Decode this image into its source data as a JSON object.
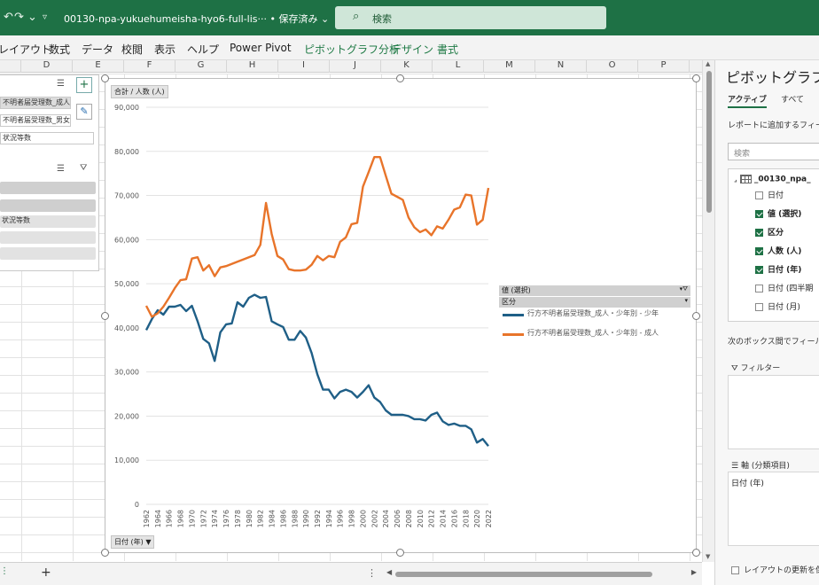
{
  "titlebar": {
    "undo_icon": "↶",
    "redo_icon": "↷ ⌄",
    "qa_more": "▿",
    "filename": "00130-npa-yukuehumeisha-hyo6-full-lis··· • 保存済み ⌄",
    "search_placeholder": "検索",
    "search_icon": "search-icon",
    "color": "#1e7145"
  },
  "menu": {
    "items": [
      "レイアウト",
      "数式",
      "データ",
      "校閲",
      "表示",
      "ヘルプ",
      "Power Pivot"
    ],
    "context_items": [
      "ピボットグラフ分析",
      "デザイン",
      "書式"
    ]
  },
  "columns": [
    "D",
    "E",
    "F",
    "G",
    "H",
    "I",
    "J",
    "K",
    "L",
    "M",
    "N",
    "O",
    "P"
  ],
  "field_panel": {
    "rows": [
      "不明者届受理数_成人・少",
      "不明者届受理数_男女別",
      "状況等数"
    ],
    "mid_row": "状況等数",
    "add_icon": "+",
    "brush_icon": "brush-icon",
    "list_icon": "list-icon",
    "filter_icon": "filter-clear-icon"
  },
  "chart": {
    "value_button": "合計 / 人数 (人)",
    "axis_button": "日付 (年) ▼",
    "legend_header_1": "値 (選択)",
    "legend_header_2": "区分"
  },
  "chart_data": {
    "type": "line",
    "x": [
      1962,
      1963,
      1964,
      1965,
      1966,
      1967,
      1968,
      1969,
      1970,
      1971,
      1972,
      1973,
      1974,
      1975,
      1976,
      1977,
      1978,
      1979,
      1980,
      1981,
      1982,
      1983,
      1984,
      1985,
      1986,
      1987,
      1988,
      1989,
      1990,
      1991,
      1992,
      1993,
      1994,
      1995,
      1996,
      1997,
      1998,
      1999,
      2000,
      2001,
      2002,
      2003,
      2004,
      2005,
      2006,
      2007,
      2008,
      2009,
      2010,
      2011,
      2012,
      2013,
      2014,
      2015,
      2016,
      2017,
      2018,
      2019,
      2020,
      2021,
      2022
    ],
    "xticks": [
      1962,
      1964,
      1966,
      1968,
      1970,
      1972,
      1974,
      1976,
      1978,
      1980,
      1982,
      1984,
      1986,
      1988,
      1990,
      1992,
      1994,
      1996,
      1998,
      2000,
      2002,
      2004,
      2006,
      2008,
      2010,
      2012,
      2014,
      2016,
      2018,
      2020,
      2022
    ],
    "yticks": [
      0,
      10000,
      20000,
      30000,
      40000,
      50000,
      60000,
      70000,
      80000,
      90000
    ],
    "ytick_labels": [
      "0",
      "10,000",
      "20,000",
      "30,000",
      "40,000",
      "50,000",
      "60,000",
      "70,000",
      "80,000",
      "90,000"
    ],
    "ylim": [
      0,
      90000
    ],
    "series": [
      {
        "name": "行方不明者届受理数_成人・少年別 - 少年",
        "color": "#1f5f87",
        "values": [
          39500,
          42000,
          44000,
          43000,
          44800,
          44800,
          45200,
          43800,
          45000,
          41500,
          37500,
          36500,
          32500,
          39000,
          40800,
          41000,
          45800,
          44800,
          46800,
          47500,
          46800,
          47000,
          41500,
          40800,
          40200,
          37300,
          37300,
          39300,
          37800,
          34300,
          29500,
          26000,
          26000,
          24000,
          25500,
          26000,
          25500,
          24200,
          25500,
          27000,
          24200,
          23200,
          21300,
          20300,
          20300,
          20300,
          20000,
          19300,
          19300,
          19000,
          20300,
          20800,
          18800,
          18000,
          18300,
          17800,
          17800,
          17000,
          14000,
          14800,
          13200
        ]
      },
      {
        "name": "行方不明者届受理数_成人・少年別 - 成人",
        "color": "#e8742a",
        "values": [
          45000,
          42500,
          43300,
          44800,
          46800,
          49000,
          50800,
          51000,
          55700,
          56000,
          53000,
          54200,
          51700,
          53700,
          54000,
          54500,
          55000,
          55500,
          56000,
          56500,
          58800,
          68300,
          61300,
          56300,
          55500,
          53300,
          53000,
          53000,
          53200,
          54300,
          56300,
          55300,
          56300,
          56000,
          59500,
          60500,
          63500,
          63800,
          72000,
          75300,
          78700,
          78700,
          74500,
          70400,
          69700,
          69000,
          65000,
          62800,
          61700,
          62300,
          61000,
          63000,
          62500,
          64500,
          66800,
          67300,
          70200,
          70000,
          63400,
          64500,
          71700
        ]
      }
    ]
  },
  "pane": {
    "title": "ピボットグラフの",
    "tabs": [
      "アクティブ",
      "すべて"
    ],
    "prompt": "レポートに追加するフィール",
    "search_placeholder": "検索",
    "table_name": "_00130_npa_",
    "fields": [
      {
        "label": "日付",
        "checked": false
      },
      {
        "label": "値 (選択)",
        "checked": true
      },
      {
        "label": "区分",
        "checked": true
      },
      {
        "label": "人数 (人)",
        "checked": true
      },
      {
        "label": "日付 (年)",
        "checked": true
      },
      {
        "label": "日付 (四半期",
        "checked": false
      },
      {
        "label": "日付 (月)",
        "checked": false
      }
    ],
    "drag_hint": "次のボックス間でフィールド",
    "filter_label": "フィルター",
    "axis_label": "軸 (分類項目)",
    "axis_chip": "日付 (年)",
    "defer_label": "レイアウトの更新を保"
  },
  "sheetbar": {
    "add": "+",
    "dots": "⋮",
    "scroll_left": "◀",
    "scroll_right": "▶"
  }
}
